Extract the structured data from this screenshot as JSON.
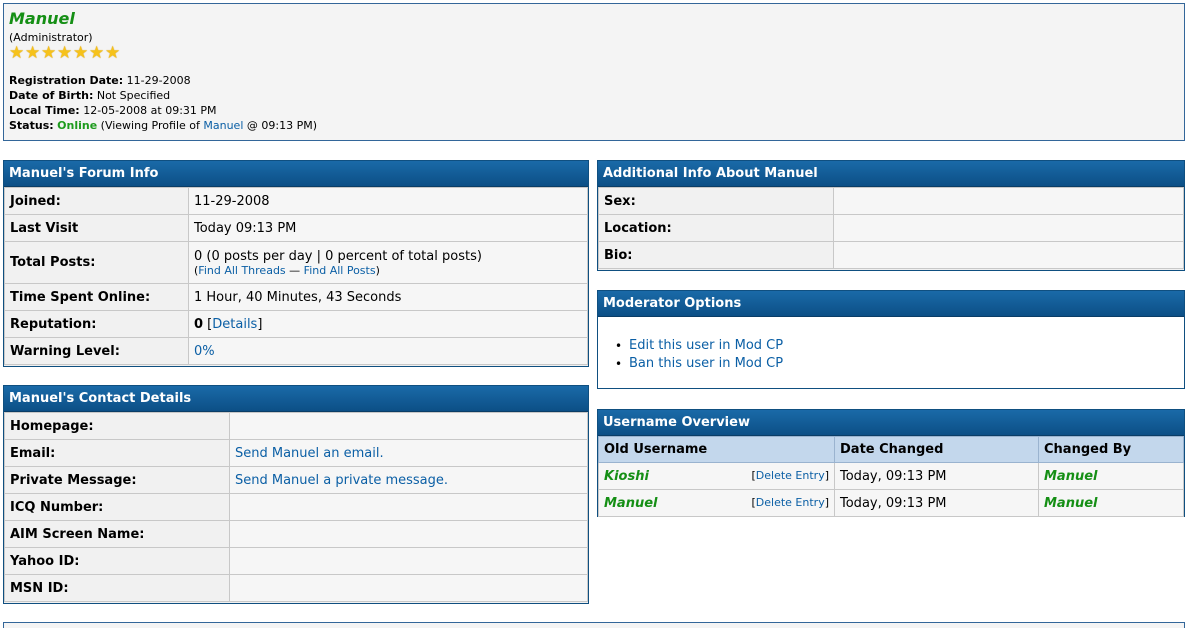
{
  "profile": {
    "username": "Manuel",
    "usertitle": "(Administrator)",
    "stars": [
      "★",
      "★",
      "★",
      "★",
      "★",
      "★",
      "★"
    ],
    "reg_label": "Registration Date:",
    "reg_value": "11-29-2008",
    "dob_label": "Date of Birth:",
    "dob_value": "Not Specified",
    "local_label": "Local Time:",
    "local_value": "12-05-2008 at 09:31 PM",
    "status_label": "Status:",
    "status_value": "Online",
    "status_pre": "(Viewing Profile of",
    "status_link": "Manuel",
    "status_post": "@ 09:13 PM)"
  },
  "forum_info": {
    "title": "Manuel's Forum Info",
    "joined_label": "Joined:",
    "joined_value": "11-29-2008",
    "lastvisit_label": "Last Visit",
    "lastvisit_value": "Today 09:13 PM",
    "posts_label": "Total Posts:",
    "posts_value": "0 (0 posts per day | 0 percent of total posts)",
    "find_threads": "Find All Threads",
    "find_sep": "—",
    "find_posts": "Find All Posts",
    "time_label": "Time Spent Online:",
    "time_value": "1 Hour, 40 Minutes, 43 Seconds",
    "rep_label": "Reputation:",
    "rep_value": "0",
    "rep_details": "Details",
    "warn_label": "Warning Level:",
    "warn_value": "0%"
  },
  "contact": {
    "title": "Manuel's Contact Details",
    "homepage_label": "Homepage:",
    "email_label": "Email:",
    "email_link": "Send Manuel an email.",
    "pm_label": "Private Message:",
    "pm_link": "Send Manuel a private message.",
    "icq_label": "ICQ Number:",
    "aim_label": "AIM Screen Name:",
    "yahoo_label": "Yahoo ID:",
    "msn_label": "MSN ID:"
  },
  "additional": {
    "title": "Additional Info About Manuel",
    "sex_label": "Sex:",
    "location_label": "Location:",
    "bio_label": "Bio:"
  },
  "moderator": {
    "title": "Moderator Options",
    "edit_link": "Edit this user in Mod CP",
    "ban_link": "Ban this user in Mod CP"
  },
  "history": {
    "title": "Username Overview",
    "col_old": "Old Username",
    "col_date": "Date Changed",
    "col_by": "Changed By",
    "delete_label": "Delete Entry",
    "rows": [
      {
        "old": "Kioshi",
        "date": "Today, 09:13 PM",
        "by": "Manuel"
      },
      {
        "old": "Manuel",
        "date": "Today, 09:13 PM",
        "by": "Manuel"
      }
    ]
  }
}
